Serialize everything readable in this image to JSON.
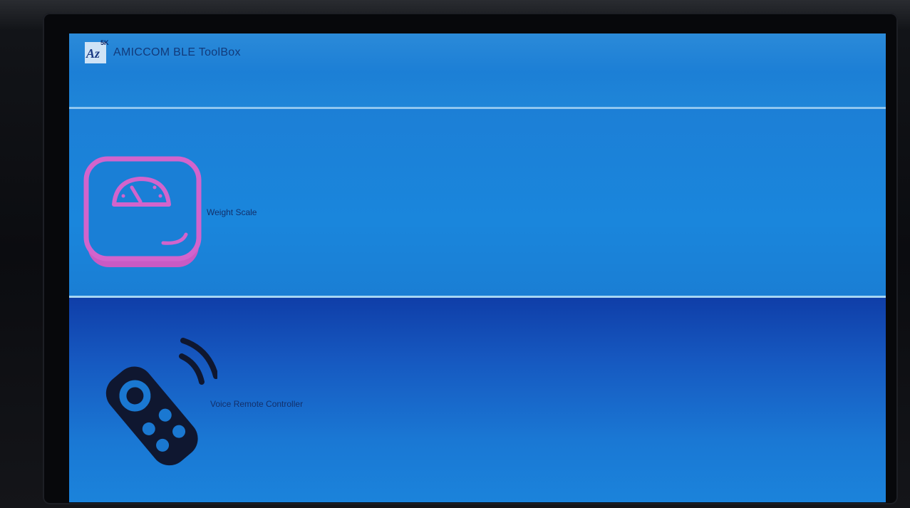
{
  "app": {
    "title": "AMICCOM BLE ToolBox",
    "logo_text": "Az",
    "logo_superscript": "5K"
  },
  "list": {
    "items": [
      {
        "label": "Weight Scale",
        "icon": "weight-scale-icon"
      },
      {
        "label": "Voice Remote Controller",
        "icon": "remote-control-icon"
      }
    ]
  },
  "colors": {
    "screen_blue": "#1a78d1",
    "weight_icon_magenta": "#cf5fc9",
    "remote_icon_dark": "#111a33",
    "divider": "#a7d6f3"
  }
}
